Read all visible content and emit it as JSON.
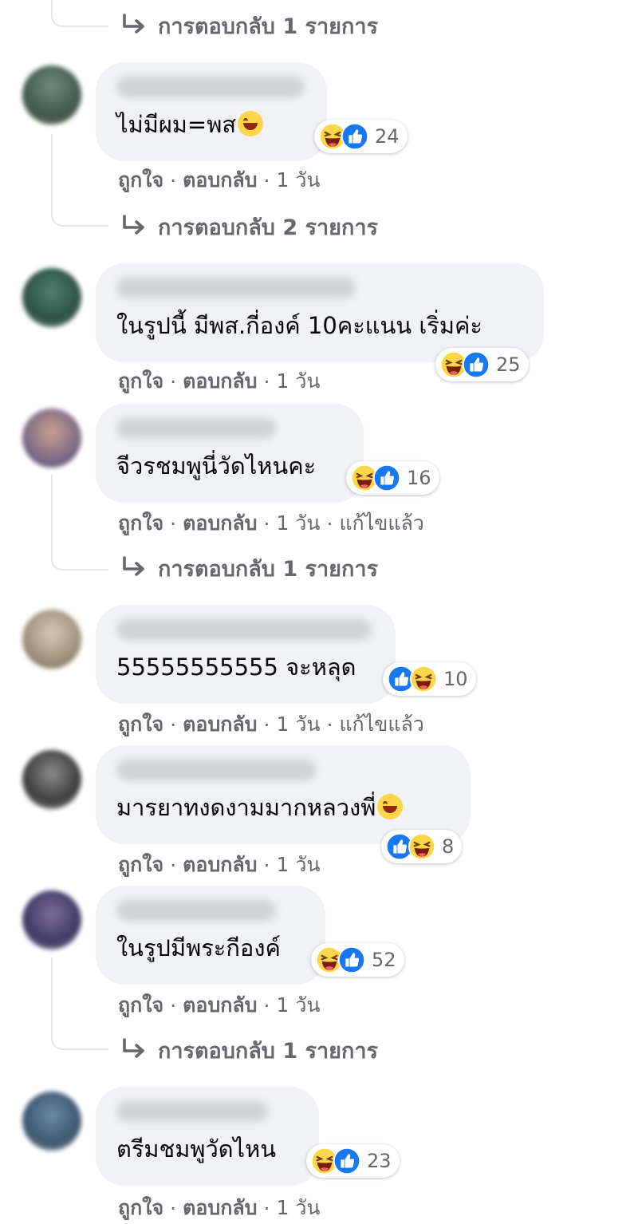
{
  "colors": {
    "bubble": "#f0f2f5",
    "meta_text": "#65676b",
    "like_blue": "#1877f2",
    "haha_yellow": "#ffd54a"
  },
  "icons": {
    "reply_arrow": "reply-arrow-icon",
    "haha": "haha-reaction-icon",
    "like": "like-reaction-icon"
  },
  "reply_links": [
    {
      "label": "การตอบกลับ 1 รายการ"
    },
    {
      "label": "การตอบกลับ 2 รายการ"
    },
    {
      "label": "การตอบกลับ 1 รายการ"
    },
    {
      "label": "การตอบกลับ 1 รายการ"
    }
  ],
  "comments": [
    {
      "text": "ไม่มีผม=พส",
      "emoji_inline": "grinning-sweat-emoji",
      "reactions": [
        "haha",
        "like"
      ],
      "count": "24",
      "like": "ถูกใจ",
      "reply": "ตอบกลับ",
      "time": "1 วัน",
      "edited": ""
    },
    {
      "text": "ในรูปนี้ มีพส.กี่องค์ 10คะแนน เริ่มค่ะ",
      "reactions": [
        "haha",
        "like"
      ],
      "count": "25",
      "like": "ถูกใจ",
      "reply": "ตอบกลับ",
      "time": "1 วัน",
      "edited": ""
    },
    {
      "text": "จีวรชมพูนี่วัดไหนคะ",
      "reactions": [
        "haha",
        "like"
      ],
      "count": "16",
      "like": "ถูกใจ",
      "reply": "ตอบกลับ",
      "time": "1 วัน",
      "edited": "แก้ไขแล้ว"
    },
    {
      "text": "55555555555 จะหลุด",
      "reactions": [
        "like",
        "haha"
      ],
      "count": "10",
      "like": "ถูกใจ",
      "reply": "ตอบกลับ",
      "time": "1 วัน",
      "edited": "แก้ไขแล้ว"
    },
    {
      "text": "มารยาทงดงามมากหลวงพี่",
      "emoji_inline": "rolling-laughing-emoji",
      "reactions": [
        "like",
        "haha"
      ],
      "count": "8",
      "like": "ถูกใจ",
      "reply": "ตอบกลับ",
      "time": "1 วัน",
      "edited": ""
    },
    {
      "text": "ในรูปมีพระกีองค์",
      "reactions": [
        "haha",
        "like"
      ],
      "count": "52",
      "like": "ถูกใจ",
      "reply": "ตอบกลับ",
      "time": "1 วัน",
      "edited": ""
    },
    {
      "text": "ตรีมชมพูวัดไหน",
      "reactions": [
        "haha",
        "like"
      ],
      "count": "23",
      "like": "ถูกใจ",
      "reply": "ตอบกลับ",
      "time": "1 วัน",
      "edited": ""
    }
  ]
}
